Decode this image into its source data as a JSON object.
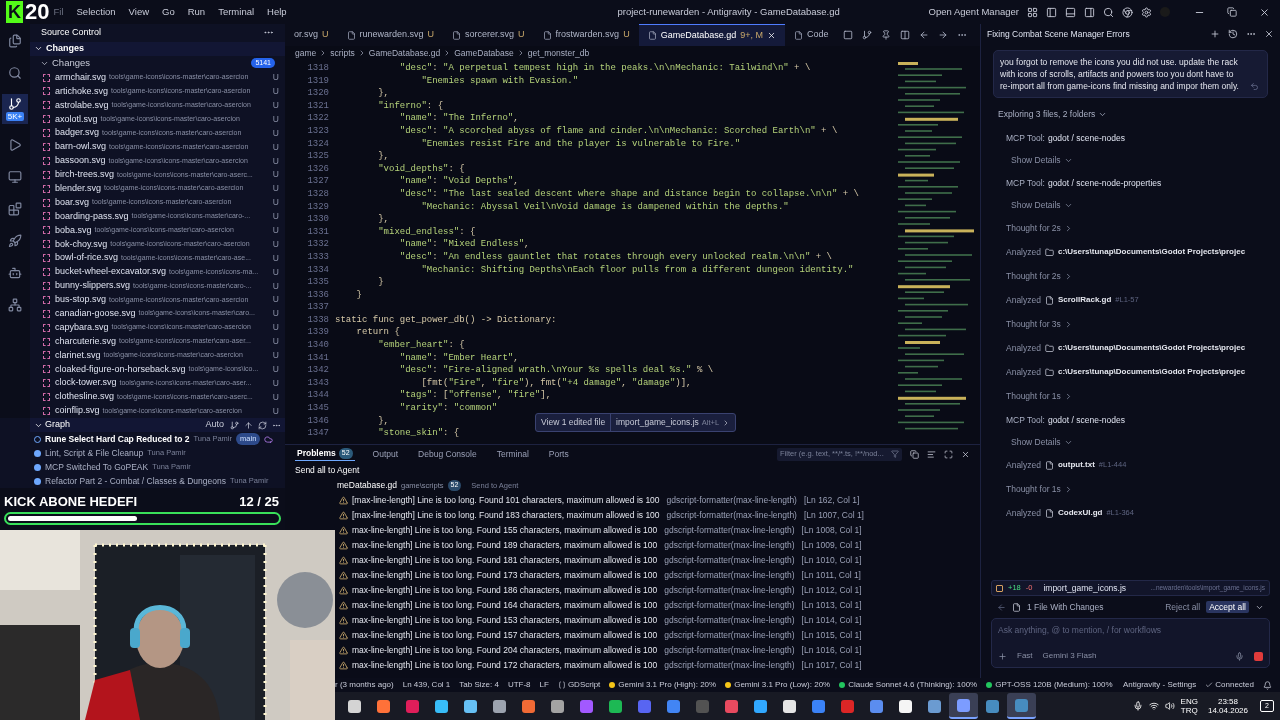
{
  "logo": {
    "letter": "K",
    "number": "20"
  },
  "menu": [
    "Fil",
    "Selection",
    "View",
    "Go",
    "Run",
    "Terminal",
    "Help"
  ],
  "window_title": "project-runewarden - Antigravity - GameDatabase.gd",
  "agent_manager": "Open Agent Manager",
  "activity_bar": [
    {
      "kind": "files",
      "selected": false
    },
    {
      "kind": "search",
      "selected": false
    },
    {
      "kind": "source",
      "selected": true,
      "badge": "5K+"
    },
    {
      "kind": "run",
      "selected": false
    },
    {
      "kind": "remote",
      "selected": false
    },
    {
      "kind": "extensions",
      "selected": false
    },
    {
      "kind": "rocket",
      "selected": false
    },
    {
      "kind": "robot",
      "selected": false
    },
    {
      "kind": "graph",
      "selected": false
    }
  ],
  "source_control": {
    "title": "Source Control",
    "section": "Changes",
    "group": "Changes",
    "count": "5141",
    "files": [
      {
        "name": "armchair.svg",
        "path": "tools\\game-icons\\icons-master\\caro-asercion",
        "status": "U"
      },
      {
        "name": "artichoke.svg",
        "path": "tools\\game-icons\\icons-master\\caro-asercion",
        "status": "U"
      },
      {
        "name": "astrolabe.svg",
        "path": "tools\\game-icons\\icons-master\\caro-asercion",
        "status": "U"
      },
      {
        "name": "axolotl.svg",
        "path": "tools\\game-icons\\icons-master\\caro-asercion",
        "status": "U"
      },
      {
        "name": "badger.svg",
        "path": "tools\\game-icons\\icons-master\\caro-asercion",
        "status": "U"
      },
      {
        "name": "barn-owl.svg",
        "path": "tools\\game-icons\\icons-master\\caro-asercion",
        "status": "U"
      },
      {
        "name": "bassoon.svg",
        "path": "tools\\game-icons\\icons-master\\caro-asercion",
        "status": "U"
      },
      {
        "name": "birch-trees.svg",
        "path": "tools\\game-icons\\icons-master\\caro-aserc...",
        "status": "U"
      },
      {
        "name": "blender.svg",
        "path": "tools\\game-icons\\icons-master\\caro-asercion",
        "status": "U"
      },
      {
        "name": "boar.svg",
        "path": "tools\\game-icons\\icons-master\\caro-asercion",
        "status": "U"
      },
      {
        "name": "boarding-pass.svg",
        "path": "tools\\game-icons\\icons-master\\caro-...",
        "status": "U"
      },
      {
        "name": "boba.svg",
        "path": "tools\\game-icons\\icons-master\\caro-asercion",
        "status": "U"
      },
      {
        "name": "bok-choy.svg",
        "path": "tools\\game-icons\\icons-master\\caro-asercion",
        "status": "U"
      },
      {
        "name": "bowl-of-rice.svg",
        "path": "tools\\game-icons\\icons-master\\caro-ase...",
        "status": "U"
      },
      {
        "name": "bucket-wheel-excavator.svg",
        "path": "tools\\game-icons\\icons-ma...",
        "status": "U"
      },
      {
        "name": "bunny-slippers.svg",
        "path": "tools\\game-icons\\icons-master\\caro-...",
        "status": "U"
      },
      {
        "name": "bus-stop.svg",
        "path": "tools\\game-icons\\icons-master\\caro-asercion",
        "status": "U"
      },
      {
        "name": "canadian-goose.svg",
        "path": "tools\\game-icons\\icons-master\\caro...",
        "status": "U"
      },
      {
        "name": "capybara.svg",
        "path": "tools\\game-icons\\icons-master\\caro-asercion",
        "status": "U"
      },
      {
        "name": "charcuterie.svg",
        "path": "tools\\game-icons\\icons-master\\caro-aser...",
        "status": "U"
      },
      {
        "name": "clarinet.svg",
        "path": "tools\\game-icons\\icons-master\\caro-asercion",
        "status": "U"
      },
      {
        "name": "cloaked-figure-on-horseback.svg",
        "path": "tools\\game-icons\\ico...",
        "status": "U"
      },
      {
        "name": "clock-tower.svg",
        "path": "tools\\game-icons\\icons-master\\caro-aser...",
        "status": "U"
      },
      {
        "name": "clothesline.svg",
        "path": "tools\\game-icons\\icons-master\\caro-aserc...",
        "status": "U"
      },
      {
        "name": "coinflip.svg",
        "path": "tools\\game-icons\\icons-master\\caro-asercion",
        "status": "U"
      }
    ]
  },
  "graph": {
    "title": "Graph",
    "mode": "Auto",
    "commits": [
      {
        "message": "Rune Select Hard Cap Reduced to 2",
        "author": "Tuna Pamir",
        "branch": "main"
      },
      {
        "message": "Lint, Script & File Cleanup",
        "author": "Tuna Pamir"
      },
      {
        "message": "MCP Switched To GoPEAK",
        "author": "Tuna Pamir"
      },
      {
        "message": "Refactor Part 2 - Combat / Classes & Dungeons",
        "author": "Tuna Pamir"
      }
    ]
  },
  "goal": {
    "title": "KICK ABONE HEDEFI",
    "count": "12 / 25",
    "level": 0.48
  },
  "tabs": [
    {
      "label": "or.svg",
      "status": "U",
      "selected": false
    },
    {
      "label": "runewarden.svg",
      "status": "U",
      "selected": false
    },
    {
      "label": "sorcerer.svg",
      "status": "U",
      "selected": false
    },
    {
      "label": "frostwarden.svg",
      "status": "U",
      "selected": false
    },
    {
      "label": "GameDatabase.gd",
      "status": "9+, M",
      "selected": true
    },
    {
      "label": "Code",
      "selected": false
    }
  ],
  "breadcrumbs": [
    "game",
    "scripts",
    "GameDatabase.gd",
    "GameDatabase",
    "get_monster_db"
  ],
  "code": [
    {
      "n": "1318",
      "text": "            \"desc\": \"A perpetual tempest high in the peaks.\\n\\nMechanic: Tailwind\\n\" + \\"
    },
    {
      "n": "1319",
      "text": "                \"Enemies spawn with Evasion.\""
    },
    {
      "n": "1320",
      "text": "        },"
    },
    {
      "n": "1321",
      "text": "        \"inferno\": {"
    },
    {
      "n": "1322",
      "text": "            \"name\": \"The Inferno\","
    },
    {
      "n": "1323",
      "text": "            \"desc\": \"A scorched abyss of flame and cinder.\\n\\nMechanic: Scorched Earth\\n\" + \\"
    },
    {
      "n": "1324",
      "text": "                \"Enemies resist Fire and the player is vulnerable to Fire.\""
    },
    {
      "n": "1325",
      "text": "        },"
    },
    {
      "n": "1326",
      "text": "        \"void_depths\": {"
    },
    {
      "n": "1327",
      "text": "            \"name\": \"Void Depths\","
    },
    {
      "n": "1328",
      "text": "            \"desc\": \"The last sealed descent where shape and distance begin to collapse.\\n\\n\" + \\"
    },
    {
      "n": "1329",
      "text": "                \"Mechanic: Abyssal Veil\\nVoid damage is dampened within the depths.\""
    },
    {
      "n": "1330",
      "text": "        },"
    },
    {
      "n": "1331",
      "text": "        \"mixed_endless\": {"
    },
    {
      "n": "1332",
      "text": "            \"name\": \"Mixed Endless\","
    },
    {
      "n": "1333",
      "text": "            \"desc\": \"An endless gauntlet that rotates through every unlocked realm.\\n\\n\" + \\"
    },
    {
      "n": "1334",
      "text": "                \"Mechanic: Shifting Depths\\nEach floor pulls from a different dungeon identity.\""
    },
    {
      "n": "1335",
      "text": "        }"
    },
    {
      "n": "1336",
      "text": "    }"
    },
    {
      "n": "1337"
    },
    {
      "n": "1338",
      "text": "static func get_power_db() -> Dictionary:"
    },
    {
      "n": "1339",
      "text": "    return {"
    },
    {
      "n": "1340",
      "text": "        \"ember_heart\": {"
    },
    {
      "n": "1341",
      "text": "            \"name\": \"Ember Heart\","
    },
    {
      "n": "1342",
      "text": "            \"desc\": \"Fire-aligned wrath.\\nYour %s spells deal %s.\" % \\"
    },
    {
      "n": "1343",
      "text": "                [fmt(\"Fire\", \"fire\"), fmt(\"+4 damage\", \"damage\")],"
    },
    {
      "n": "1344",
      "text": "            \"tags\": [\"offense\", \"fire\"],"
    },
    {
      "n": "1345",
      "text": "            \"rarity\": \"common\""
    },
    {
      "n": "1346",
      "text": "        },"
    },
    {
      "n": "1347",
      "text": "        \"stone_skin\": {"
    }
  ],
  "edit_popup": {
    "label": "View 1 edited file",
    "file": "import_game_icons.js",
    "shortcut": "Alt+L"
  },
  "panel": {
    "tabs": [
      {
        "label": "Problems",
        "count": "52",
        "selected": true
      },
      {
        "label": "Output",
        "selected": false
      },
      {
        "label": "Debug Console",
        "selected": false
      },
      {
        "label": "Terminal",
        "selected": false
      },
      {
        "label": "Ports",
        "selected": false
      }
    ],
    "filter_placeholder": "Filter (e.g. text, **/*.ts, !**/nod...",
    "send_all": "Send all to Agent",
    "file": {
      "name": "meDatabase.gd",
      "path": "game\\scripts",
      "count": "52",
      "action": "Send to Agent"
    },
    "problems": [
      {
        "message": "[max-line-length] Line is too long. Found 101 characters, maximum allowed is 100",
        "source": "gdscript-formatter(max-line-length)",
        "location": "[Ln 162, Col 1]"
      },
      {
        "message": "[max-line-length] Line is too long. Found 183 characters, maximum allowed is 100",
        "source": "gdscript-formatter(max-line-length)",
        "location": "[Ln 1007, Col 1]"
      },
      {
        "message": "max-line-length] Line is too long. Found 155 characters, maximum allowed is 100",
        "source": "gdscript-formatter(max-line-length)",
        "location": "[Ln 1008, Col 1]"
      },
      {
        "message": "max-line-length] Line is too long. Found 189 characters, maximum allowed is 100",
        "source": "gdscript-formatter(max-line-length)",
        "location": "[Ln 1009, Col 1]"
      },
      {
        "message": "max-line-length] Line is too long. Found 181 characters, maximum allowed is 100",
        "source": "gdscript-formatter(max-line-length)",
        "location": "[Ln 1010, Col 1]"
      },
      {
        "message": "max-line-length] Line is too long. Found 173 characters, maximum allowed is 100",
        "source": "gdscript-formatter(max-line-length)",
        "location": "[Ln 1011, Col 1]"
      },
      {
        "message": "max-line-length] Line is too long. Found 186 characters, maximum allowed is 100",
        "source": "gdscript-formatter(max-line-length)",
        "location": "[Ln 1012, Col 1]"
      },
      {
        "message": "max-line-length] Line is too long. Found 164 characters, maximum allowed is 100",
        "source": "gdscript-formatter(max-line-length)",
        "location": "[Ln 1013, Col 1]"
      },
      {
        "message": "max-line-length] Line is too long. Found 153 characters, maximum allowed is 100",
        "source": "gdscript-formatter(max-line-length)",
        "location": "[Ln 1014, Col 1]"
      },
      {
        "message": "max-line-length] Line is too long. Found 157 characters, maximum allowed is 100",
        "source": "gdscript-formatter(max-line-length)",
        "location": "[Ln 1015, Col 1]"
      },
      {
        "message": "max-line-length] Line is too long. Found 204 characters, maximum allowed is 100",
        "source": "gdscript-formatter(max-line-length)",
        "location": "[Ln 1016, Col 1]"
      },
      {
        "message": "max-line-length] Line is too long. Found 172 characters, maximum allowed is 100",
        "source": "gdscript-formatter(max-line-length)",
        "location": "[Ln 1017, Col 1]"
      }
    ]
  },
  "agent": {
    "title": "Fixing Combat Scene Manager Errors",
    "message": "you forgot to remove the icons you did not use. update the rack with icons of scrolls, artifacts and powers too you dont have to re-import all from game-icons find missing and impor them only.",
    "summary": "Exploring 3 files, 2 folders",
    "steps": [
      {
        "kind": "tool",
        "label": "MCP Tool:",
        "value": "godot / scene-nodes",
        "details": "Show Details"
      },
      {
        "kind": "tool",
        "label": "MCP Tool:",
        "value": "godot / scene-node-properties",
        "details": "Show Details"
      },
      {
        "kind": "thought",
        "label": "Thought for 2s"
      },
      {
        "kind": "folder",
        "label": "Analyzed",
        "value": "c:\\Users\\tunap\\Documents\\Godot Projects\\projec"
      },
      {
        "kind": "thought",
        "label": "Thought for 2s"
      },
      {
        "kind": "file",
        "label": "Analyzed",
        "value": "ScrollRack.gd",
        "range": "#L1-57"
      },
      {
        "kind": "thought",
        "label": "Thought for 3s"
      },
      {
        "kind": "folder",
        "label": "Analyzed",
        "value": "c:\\Users\\tunap\\Documents\\Godot Projects\\projec"
      },
      {
        "kind": "folder",
        "label": "Analyzed",
        "value": "c:\\Users\\tunap\\Documents\\Godot Projects\\projec"
      },
      {
        "kind": "thought",
        "label": "Thought for 1s"
      },
      {
        "kind": "tool",
        "label": "MCP Tool:",
        "value": "godot / scene-nodes",
        "details": "Show Details"
      },
      {
        "kind": "file",
        "label": "Analyzed",
        "value": "output.txt",
        "range": "#L1-444"
      },
      {
        "kind": "thought",
        "label": "Thought for 1s"
      },
      {
        "kind": "file",
        "label": "Analyzed",
        "value": "CodexUI.gd",
        "range": "#L1-364"
      }
    ],
    "change": {
      "added": "+18",
      "removed": "-0",
      "file": "import_game_icons.js",
      "path": "...newarden\\tools\\import_game_icons.js"
    },
    "changes_summary": "1 File With Changes",
    "reject": "Reject all",
    "accept": "Accept all",
    "input_placeholder": "Ask anything, @ to mention, / for workflows",
    "mode": "Fast",
    "model": "Gemini 3 Flash"
  },
  "status_bar": [
    {
      "kind": "text",
      "text": "r (3 months ago)"
    },
    {
      "kind": "text",
      "text": "Ln 439, Col 1"
    },
    {
      "kind": "text",
      "text": "Tab Size: 4"
    },
    {
      "kind": "text",
      "text": "UTF-8"
    },
    {
      "kind": "text",
      "text": "LF"
    },
    {
      "kind": "language",
      "text": "GDScript"
    },
    {
      "kind": "quota",
      "text": "Gemini 3.1 Pro (High): 20%",
      "color": "#f5c518"
    },
    {
      "kind": "quota",
      "text": "Gemini 3.1 Pro (Low): 20%",
      "color": "#f5c518"
    },
    {
      "kind": "quota",
      "text": "Claude Sonnet 4.6 (Thinking): 100%",
      "color": "#22c55e"
    },
    {
      "kind": "quota",
      "text": "GPT-OSS 120B (Medium): 100%",
      "color": "#22c55e"
    },
    {
      "kind": "text",
      "text": "Antigravity - Settings"
    },
    {
      "kind": "connected",
      "text": "Connected"
    }
  ],
  "taskbar": {
    "apps": [
      {
        "color": "#d4d4d4",
        "selected": false
      },
      {
        "color": "#ff7139",
        "selected": false
      },
      {
        "color": "#e01e5a",
        "selected": false
      },
      {
        "color": "#38bdf8",
        "selected": false
      },
      {
        "color": "#66c0f4",
        "selected": false
      },
      {
        "color": "#9ca3af",
        "selected": false
      },
      {
        "color": "#f06a35",
        "selected": false
      },
      {
        "color": "#a3a3a3",
        "selected": false
      },
      {
        "color": "#a259ff",
        "selected": false
      },
      {
        "color": "#1db954",
        "selected": false
      },
      {
        "color": "#5865f2",
        "selected": false
      },
      {
        "color": "#4285f4",
        "selected": false
      },
      {
        "color": "#525252",
        "selected": false
      },
      {
        "color": "#e84a5f",
        "selected": false
      },
      {
        "color": "#31a8ff",
        "selected": false
      },
      {
        "color": "#e5e5e5",
        "selected": false
      },
      {
        "color": "#3b82f6",
        "selected": false
      },
      {
        "color": "#dc2626",
        "selected": false
      },
      {
        "color": "#5b8def",
        "selected": false
      },
      {
        "color": "#f5f5f5",
        "selected": false
      },
      {
        "color": "#6b9bd1",
        "selected": false
      },
      {
        "color": "#7c9cff",
        "selected": true
      },
      {
        "color": "#478cbf",
        "selected": false
      },
      {
        "color": "#478cbf",
        "selected": true
      }
    ],
    "lang": "ENG",
    "layout": "TRQ",
    "time": "23:58",
    "date": "14.04.2026",
    "notifications": "2"
  }
}
